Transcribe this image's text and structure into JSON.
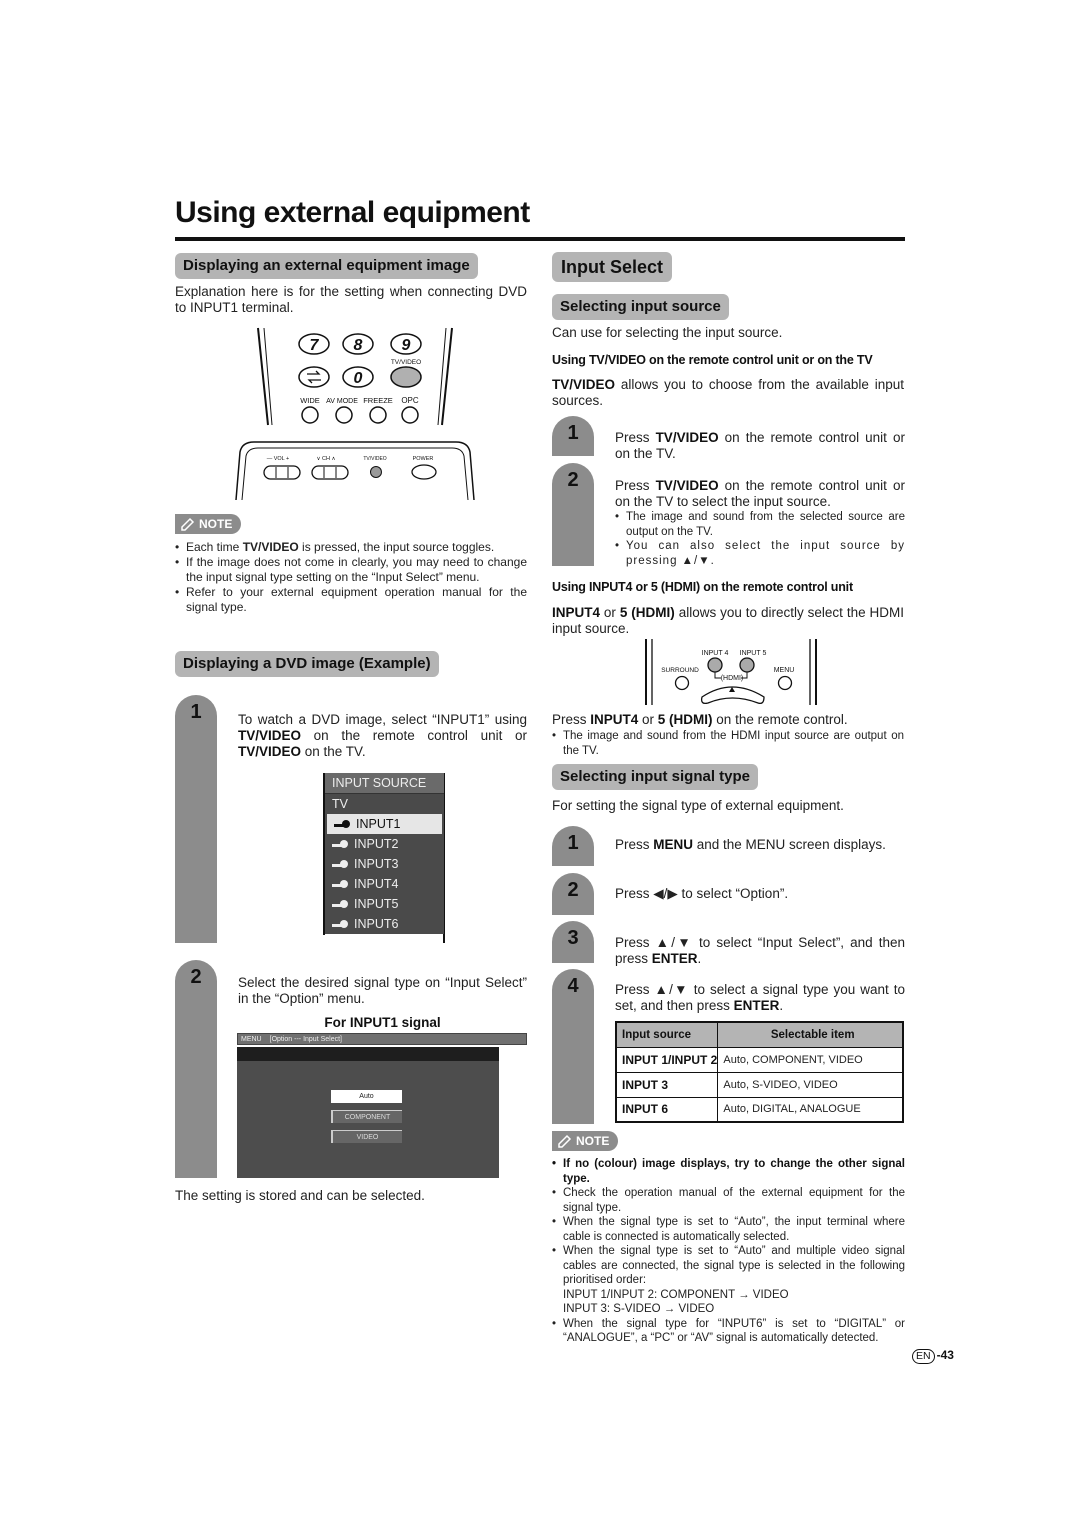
{
  "page_title": "Using external equipment",
  "left": {
    "section1": {
      "heading": "Displaying an external equipment image",
      "intro": "Explanation here is for the setting when connecting DVD to INPUT1 terminal.",
      "remote": {
        "keys": [
          "7",
          "8",
          "9",
          "0"
        ],
        "flashback_icon": "flashback-icon",
        "tv_video_label": "TV/VIDEO",
        "small_buttons": [
          "WIDE",
          "AV MODE",
          "FREEZE",
          "OPC"
        ]
      },
      "tv_panel": {
        "labels": [
          "— VOL +",
          "∨ CH ∧",
          "TV/VIDEO",
          "POWER"
        ]
      },
      "note_label": "NOTE",
      "notes": [
        {
          "pre": "Each time ",
          "bold": "TV/VIDEO",
          "post": " is pressed, the input source toggles."
        },
        {
          "pre": "If the image does not come in clearly, you may need to change the input signal type setting on the “Input Select” menu.",
          "bold": "",
          "post": ""
        },
        {
          "pre": "Refer to your external equipment operation manual for the signal type.",
          "bold": "",
          "post": ""
        }
      ]
    },
    "section2": {
      "heading": "Displaying a DVD image (Example)",
      "step1": {
        "num": "1",
        "text_pre": "To watch a DVD image, select “INPUT1” using ",
        "bold1": "TV/VIDEO",
        "text_mid": " on the remote control unit or ",
        "bold2": "TV/VIDEO",
        "text_post": "  on the TV."
      },
      "input_menu": {
        "header": "INPUT SOURCE",
        "items": [
          "TV",
          "INPUT1",
          "INPUT2",
          "INPUT3",
          "INPUT4",
          "INPUT5",
          "INPUT6"
        ],
        "selected": "INPUT1"
      },
      "step2": {
        "num": "2",
        "text": "Select the desired signal type on “Input Select” in the “Option” menu.",
        "caption": "For INPUT1 signal"
      },
      "osd": {
        "menu_label": "MENU",
        "breadcrumb": "[Option --- Input Select]",
        "options": [
          "Auto",
          "COMPONENT",
          "VIDEO"
        ],
        "selected": "Auto"
      },
      "footer": "The setting is stored and can be selected."
    }
  },
  "right": {
    "heading": "Input Select",
    "source": {
      "heading": "Selecting input source",
      "intro": "Can use for selecting the input source.",
      "sub1": "Using TV/VIDEO on the remote control unit or on the TV",
      "sub1_text_bold": "TV/VIDEO",
      "sub1_text": " allows you to choose from the available input sources.",
      "steps": [
        {
          "num": "1",
          "pre": "Press ",
          "bold": "TV/VIDEO",
          "post": " on the remote control unit or on the TV."
        },
        {
          "num": "2",
          "pre": "Press ",
          "bold": "TV/VIDEO",
          "post": " on the remote control unit or on the TV to select the input source."
        }
      ],
      "step2_bullets": [
        "The image and sound from the selected source are output on the TV.",
        "You can also select the input source by pressing ▲/▼."
      ],
      "sub2": "Using INPUT4 or 5 (HDMI) on the remote control unit",
      "sub2_bold1": "INPUT4",
      "sub2_mid": " or ",
      "sub2_bold2": "5 (HDMI)",
      "sub2_text": " allows you to directly select the HDMI input source.",
      "hdmi_remote": {
        "labels": [
          "INPUT 4",
          "INPUT 5",
          "SURROUND",
          "MENU",
          "(HDMI)"
        ]
      },
      "press_pre": "Press ",
      "press_bold1": "INPUT4",
      "press_mid": " or ",
      "press_bold2": "5 (HDMI)",
      "press_post": " on the remote control.",
      "press_bullet": "The image and sound from the HDMI input source are output on the TV."
    },
    "signal": {
      "heading": "Selecting input signal type",
      "intro": "For setting the signal type of external equipment.",
      "steps": [
        {
          "num": "1",
          "pre": "Press ",
          "bold": "MENU",
          "post": " and the MENU screen displays."
        },
        {
          "num": "2",
          "pre": "Press ◀/▶ to select “Option”.",
          "bold": "",
          "post": ""
        },
        {
          "num": "3",
          "pre": "Press ▲/▼ to select “Input Select”, and then press ",
          "bold": "ENTER",
          "post": "."
        },
        {
          "num": "4",
          "pre": "Press ▲/▼ to select a signal type you want to set, and then press ",
          "bold": "ENTER",
          "post": "."
        }
      ],
      "table": {
        "headers": [
          "Input source",
          "Selectable item"
        ],
        "rows": [
          [
            "INPUT 1/INPUT 2",
            "Auto, COMPONENT, VIDEO"
          ],
          [
            "INPUT 3",
            "Auto, S-VIDEO, VIDEO"
          ],
          [
            "INPUT 6",
            "Auto, DIGITAL, ANALOGUE"
          ]
        ]
      },
      "note_label": "NOTE",
      "notes": [
        "If no (colour) image displays, try to change the other signal type.",
        "Check the operation manual of the external equipment for the signal type.",
        "When the signal type is set to “Auto”, the input terminal where cable is connected is automatically selected.",
        "When the signal type is set to “Auto” and multiple video signal cables are connected, the signal type is selected in the following prioritised order:",
        "When the signal type for “INPUT6” is set to “DIGITAL” or “ANALOGUE”, a “PC” or “AV” signal is automatically detected."
      ],
      "priority_lines": [
        "INPUT 1/INPUT 2: COMPONENT → VIDEO",
        "INPUT 3: S-VIDEO → VIDEO"
      ]
    }
  },
  "page_number": {
    "lang": "EN",
    "num": "-43"
  }
}
